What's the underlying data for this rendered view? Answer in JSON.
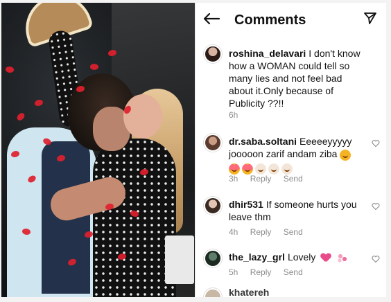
{
  "header": {
    "title": "Comments"
  },
  "icons": {
    "back": "back-arrow-icon",
    "send": "send-icon",
    "heart": "heart-icon"
  },
  "comments": [
    {
      "username": "roshina_delavari",
      "text": "I don't know how a WOMAN  could tell so many lies and not feel bad about it.Only because of Publicity ??!!",
      "time": "6h",
      "reply": "",
      "send": ""
    },
    {
      "username": "dr.saba.soltani",
      "text": "Eeeeeyyyyy jooooon zarif andam ziba",
      "time": "3h",
      "reply": "Reply",
      "send": "Send"
    },
    {
      "username": "dhir531",
      "text": "If someone hurts you leave thm",
      "time": "4h",
      "reply": "Reply",
      "send": "Send"
    },
    {
      "username": "the_lazy_grl",
      "text": "Lovely",
      "time": "5h",
      "reply": "Reply",
      "send": "Send"
    }
  ],
  "partial_comment": {
    "username_fragment": "khatereh"
  },
  "colors": {
    "petal_red": "#e0202e",
    "meta_gray": "#8b8b8b",
    "text": "#111111"
  }
}
